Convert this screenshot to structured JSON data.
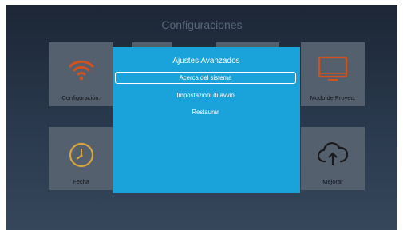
{
  "screen": {
    "title": "Configuraciones"
  },
  "tiles": [
    {
      "label": "Configuración.",
      "icon": "wifi-icon"
    },
    {
      "label": "Modo de Proyec.",
      "icon": "monitor-icon"
    },
    {
      "label": "Fecha",
      "icon": "clock-icon"
    },
    {
      "label": "Mejorar",
      "icon": "cloud-upload-icon"
    }
  ],
  "dialog": {
    "title": "Ajustes Avanzados",
    "items": [
      {
        "label": "Acerca del sistema",
        "selected": true
      },
      {
        "label": "Impostazioni di avvio",
        "selected": false
      },
      {
        "label": "Restaurar",
        "selected": false
      }
    ]
  },
  "colors": {
    "accent": "#1aa3db",
    "wifi_icon": "#d4521a",
    "monitor_icon": "#d4521a",
    "clock_icon": "#d8a43c",
    "cloud_icon": "#1a1a1a"
  }
}
